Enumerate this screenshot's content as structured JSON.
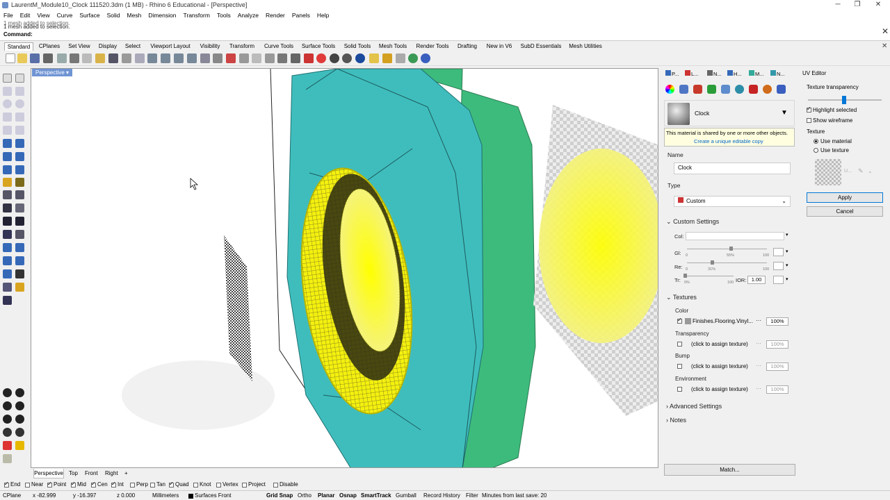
{
  "window": {
    "title": "LaurentM_Module10_Clock 111520.3dm (1 MB) - Rhino 6 Educational - [Perspective]",
    "minimize": "─",
    "maximize": "❐",
    "close": "✕"
  },
  "menu": [
    "File",
    "Edit",
    "View",
    "Curve",
    "Surface",
    "Solid",
    "Mesh",
    "Dimension",
    "Transform",
    "Tools",
    "Analyze",
    "Render",
    "Panels",
    "Help"
  ],
  "command": {
    "history_line1": "1 mesh added to selection.",
    "history_line2": "1 mesh added to selection.",
    "label": "Command:",
    "value": ""
  },
  "tabs": [
    "Standard",
    "CPlanes",
    "Set View",
    "Display",
    "Select",
    "Viewport Layout",
    "Visibility",
    "Transform",
    "Curve Tools",
    "Surface Tools",
    "Solid Tools",
    "Mesh Tools",
    "Render Tools",
    "Drafting",
    "New in V6",
    "SubD Essentials",
    "Mesh Utilities"
  ],
  "viewport": {
    "label": "Perspective",
    "tabs": [
      "Perspective",
      "Top",
      "Front",
      "Right"
    ],
    "add_tab": "+"
  },
  "osnaps": [
    {
      "label": "End",
      "checked": true
    },
    {
      "label": "Near",
      "checked": false
    },
    {
      "label": "Point",
      "checked": true
    },
    {
      "label": "Mid",
      "checked": true
    },
    {
      "label": "Cen",
      "checked": true
    },
    {
      "label": "Int",
      "checked": true
    },
    {
      "label": "Perp",
      "checked": false
    },
    {
      "label": "Tan",
      "checked": false
    },
    {
      "label": "Quad",
      "checked": true
    },
    {
      "label": "Knot",
      "checked": false
    },
    {
      "label": "Vertex",
      "checked": false
    },
    {
      "label": "Project",
      "checked": false
    },
    {
      "label": "Disable",
      "checked": false
    }
  ],
  "status": {
    "cplane": "CPlane",
    "x": "x -82.999",
    "y": "y -16.397",
    "z": "z 0.000",
    "units": "Millimeters",
    "layer": "Surfaces Front",
    "grid_snap": "Grid Snap",
    "ortho": "Ortho",
    "planar": "Planar",
    "osnap": "Osnap",
    "smarttrack": "SmartTrack",
    "gumball": "Gumball",
    "record_history": "Record History",
    "filter": "Filter",
    "save_info": "Minutes from last save: 20"
  },
  "material_panel": {
    "panel_tabs": [
      "P...",
      "L...",
      "N...",
      "H...",
      "M...",
      "N..."
    ],
    "material_name_header": "Clock",
    "shared_warning": "This material is shared by one or more other objects.",
    "create_copy_link": "Create a unique editable copy",
    "name_label": "Name",
    "name_value": "Clock",
    "type_label": "Type",
    "type_value": "Custom",
    "custom_settings": "Custom Settings",
    "col_label": "Col:",
    "gl_label": "Gl:",
    "gl_min": "0",
    "gl_value": "55%",
    "gl_max": "100",
    "gloss": 0.55,
    "re_label": "Re:",
    "re_min": "0",
    "re_value": "31%",
    "re_max": "100",
    "reflect": 0.31,
    "tr_label": "Tr:",
    "tr_min": "0%",
    "tr_max": "100",
    "transparency": 0,
    "ior_label": "IOR:",
    "ior_value": "1.00",
    "textures_label": "Textures",
    "tex_color_label": "Color",
    "tex_color_name": "Finishes.Flooring.Vinyl...",
    "tex_color_pct": "100%",
    "tex_transparency_label": "Transparency",
    "tex_transparency_name": "(click to assign texture)",
    "tex_transparency_pct": "100%",
    "tex_bump_label": "Bump",
    "tex_bump_name": "(click to assign texture)",
    "tex_bump_pct": "100%",
    "tex_env_label": "Environment",
    "tex_env_name": "(click to assign texture)",
    "tex_env_pct": "100%",
    "ellipsis": "···",
    "advanced_settings": "Advanced Settings",
    "notes": "Notes",
    "match_button": "Match..."
  },
  "uv_editor": {
    "title": "UV Editor",
    "texture_transparency": "Texture transparency",
    "transparency_level": 0.48,
    "highlight_selected": "Highlight selected",
    "show_wireframe": "Show wireframe",
    "texture_label": "Texture",
    "use_material": "Use material",
    "use_texture": "Use texture",
    "thumb_label": "U...",
    "apply": "Apply",
    "cancel": "Cancel"
  },
  "colors": {
    "viewport_label_bg": "#6f94d4",
    "teal": "#3fbdbd",
    "green": "#3dbb7c",
    "yellow": "#ffff00",
    "accent_blue": "#0078d7"
  }
}
